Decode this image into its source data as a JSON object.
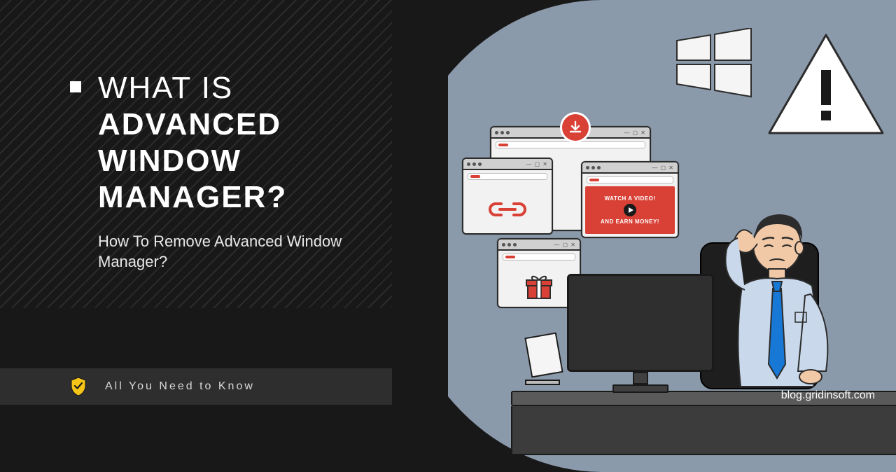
{
  "heading": {
    "line1": "WHAT IS",
    "line2": "ADVANCED",
    "line3": "WINDOW",
    "line4": "MANAGER?"
  },
  "subtitle": "How To Remove Advanced Window Manager?",
  "bottom_bar": {
    "text": "All You Need to Know",
    "icon": "shield-check-icon"
  },
  "popups": {
    "video": {
      "line1": "WATCH A VIDEO!",
      "line2": "AND EARN MONEY!"
    },
    "download_icon": "download-icon",
    "link_icon": "link-chain-icon",
    "gift_icon": "gift-icon"
  },
  "warning_icon": "exclamation-triangle-icon",
  "windows_icon": "windows-logo-icon",
  "credit": "blog.gridinsoft.com",
  "colors": {
    "accent_red": "#d94136",
    "accent_yellow": "#f5c518",
    "bg_dark": "#181818",
    "bg_blue": "#8b9aab"
  }
}
